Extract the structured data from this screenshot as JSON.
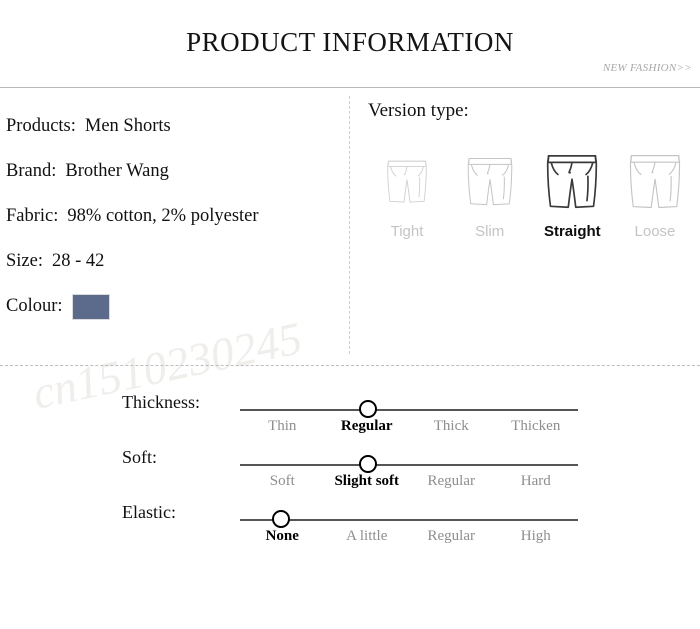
{
  "header": {
    "title": "PRODUCT INFORMATION",
    "tagline": "NEW FASHION>>"
  },
  "watermark": {
    "text": "cn1510230245"
  },
  "specs": {
    "rows": [
      {
        "label": "Products:",
        "value": "Men Shorts"
      },
      {
        "label": "Brand:",
        "value": "Brother Wang"
      },
      {
        "label": "Fabric:",
        "value": "98% cotton, 2% polyester"
      },
      {
        "label": "Size:",
        "value": "28 - 42"
      },
      {
        "label": "Colour:",
        "value": ""
      }
    ],
    "colour_swatch_hex": "#5c6b8b"
  },
  "version_type": {
    "title": "Version type:",
    "selected": "Straight",
    "options": [
      {
        "label": "Tight",
        "selected": false,
        "stroke": "#cfcfcf"
      },
      {
        "label": "Slim",
        "selected": false,
        "stroke": "#c4c4c4"
      },
      {
        "label": "Straight",
        "selected": true,
        "stroke": "#3a3a3a"
      },
      {
        "label": "Loose",
        "selected": false,
        "stroke": "#c4c4c4"
      }
    ]
  },
  "sliders": [
    {
      "name": "Thickness:",
      "options": [
        "Thin",
        "Regular",
        "Thick",
        "Thicken"
      ],
      "selected_index": 1,
      "knob_percent": 38
    },
    {
      "name": "Soft:",
      "options": [
        "Soft",
        "Slight soft",
        "Regular",
        "Hard"
      ],
      "selected_index": 1,
      "knob_percent": 38
    },
    {
      "name": "Elastic:",
      "options": [
        "None",
        "A little",
        "Regular",
        "High"
      ],
      "selected_index": 0,
      "knob_percent": 12
    }
  ]
}
